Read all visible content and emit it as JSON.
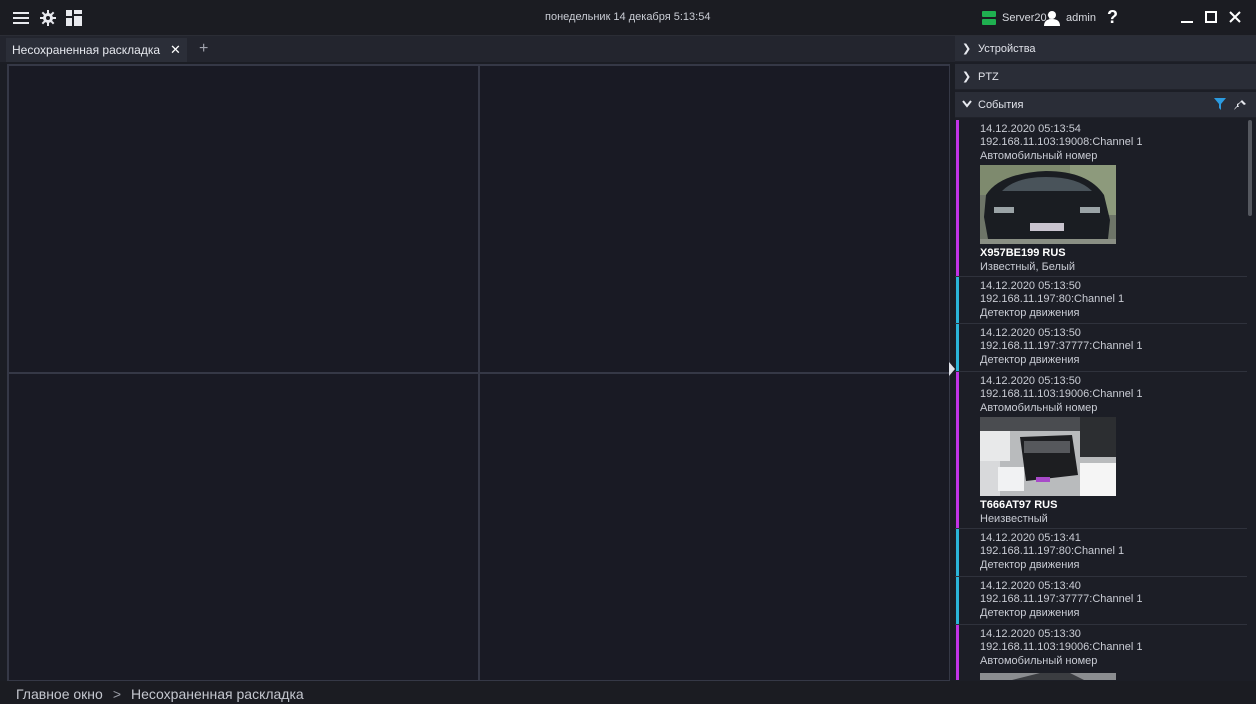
{
  "titlebar": {
    "datetime": "понедельник 14 декабря 5:13:54",
    "server_name": "Server201",
    "user_name": "admin",
    "help_glyph": "?",
    "icons": [
      "menu-icon",
      "gear-icon",
      "layout-icon"
    ]
  },
  "tabs": [
    {
      "label": "Несохраненная раскладка",
      "close_glyph": "✕"
    }
  ],
  "tab_add_glyph": "+",
  "panel": {
    "sections": [
      {
        "label": "Устройства",
        "expanded": false
      },
      {
        "label": "PTZ",
        "expanded": false
      },
      {
        "label": "События",
        "expanded": true
      }
    ],
    "events": [
      {
        "time": "14.12.2020 05:13:54",
        "source": "192.168.11.103:19008:Channel 1",
        "type": "Автомобильный номер",
        "plate": "X957BE199 RUS",
        "status": "Известный, Белый",
        "accent": "#c233e6",
        "has_thumb": true,
        "thumb_style": "color"
      },
      {
        "time": "14.12.2020 05:13:50",
        "source": "192.168.11.197:80:Channel 1",
        "type": "Детектор движения",
        "accent": "#2bb5d8"
      },
      {
        "time": "14.12.2020 05:13:50",
        "source": "192.168.11.197:37777:Channel 1",
        "type": "Детектор движения",
        "accent": "#2bb5d8"
      },
      {
        "time": "14.12.2020 05:13:50",
        "source": "192.168.11.103:19006:Channel 1",
        "type": "Автомобильный номер",
        "plate": "T666AT97 RUS",
        "status": "Неизвестный",
        "accent": "#c233e6",
        "has_thumb": true,
        "thumb_style": "bw"
      },
      {
        "time": "14.12.2020 05:13:41",
        "source": "192.168.11.197:80:Channel 1",
        "type": "Детектор движения",
        "accent": "#2bb5d8"
      },
      {
        "time": "14.12.2020 05:13:40",
        "source": "192.168.11.197:37777:Channel 1",
        "type": "Детектор движения",
        "accent": "#2bb5d8"
      },
      {
        "time": "14.12.2020 05:13:30",
        "source": "192.168.11.103:19006:Channel 1",
        "type": "Автомобильный номер",
        "accent": "#c233e6"
      }
    ]
  },
  "footer": {
    "crumbs": [
      "Главное окно",
      "Несохраненная раскладка"
    ],
    "separator": ">"
  },
  "colors": {
    "server_status": "#1fb050",
    "filter": "#2b9be0",
    "plate_accent": "#c233e6",
    "motion_accent": "#2bb5d8"
  }
}
